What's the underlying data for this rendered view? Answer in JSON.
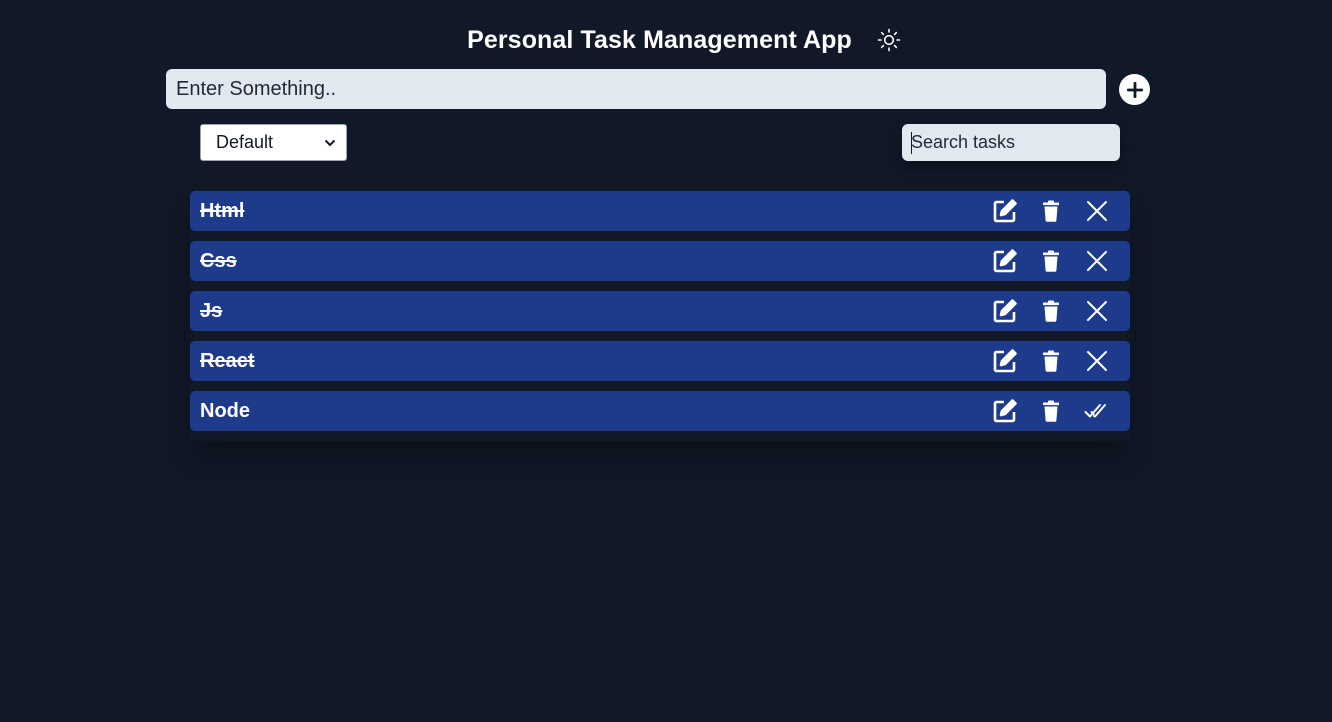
{
  "header": {
    "title": "Personal Task Management App",
    "theme_icon": "sun-icon"
  },
  "input": {
    "placeholder": "Enter Something..",
    "add_icon": "plus-icon"
  },
  "filter": {
    "selected": "Default"
  },
  "search": {
    "placeholder": "Search tasks"
  },
  "tasks": [
    {
      "name": "Html",
      "completed": true,
      "status_icon": "close-icon"
    },
    {
      "name": "Css",
      "completed": true,
      "status_icon": "close-icon"
    },
    {
      "name": "Js",
      "completed": true,
      "status_icon": "close-icon"
    },
    {
      "name": "React",
      "completed": true,
      "status_icon": "close-icon"
    },
    {
      "name": "Node",
      "completed": false,
      "status_icon": "double-check-icon"
    }
  ],
  "colors": {
    "background": "#111827",
    "task_bg": "#1e3a8a",
    "input_bg": "#e2e8f0"
  }
}
